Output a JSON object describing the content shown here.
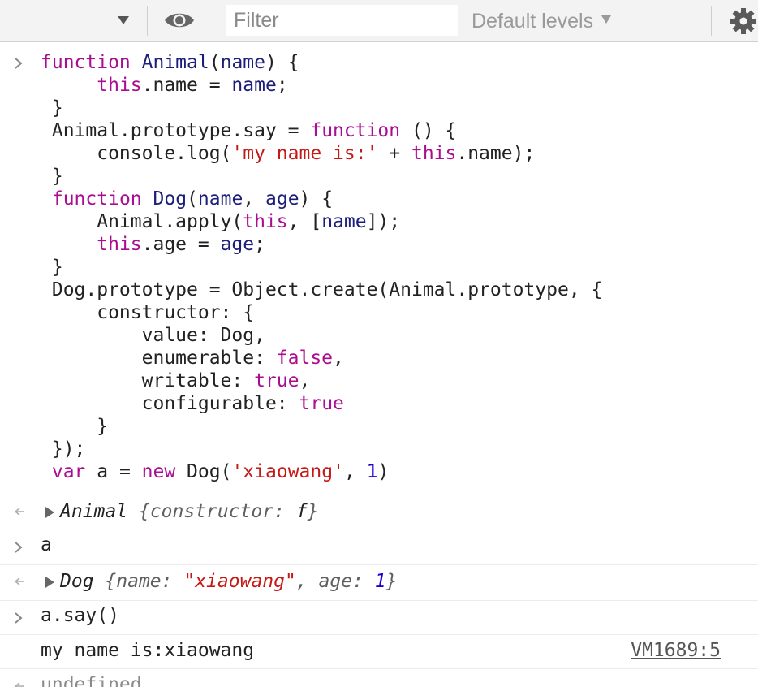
{
  "toolbar": {
    "filter_placeholder": "Filter",
    "levels_label": "Default levels",
    "icons": [
      "dropdown-arrow-icon",
      "eye-icon",
      "gear-icon"
    ]
  },
  "console": {
    "input1_lines": [
      "function Animal(name) {",
      "     this.name = name;",
      " }",
      " Animal.prototype.say = function () {",
      "     console.log('my name is:' + this.name);",
      " }",
      " function Dog(name, age) {",
      "     Animal.apply(this, [name]);",
      "     this.age = age;",
      " }",
      " Dog.prototype = Object.create(Animal.prototype, {",
      "     constructor: {",
      "         value: Dog,",
      "         enumerable: false,",
      "         writable: true,",
      "         configurable: true",
      "     }",
      " });",
      " var a = new Dog('xiaowang', 1)"
    ],
    "result1": {
      "name": "Animal",
      "open": "{",
      "key": "constructor",
      "colon": ": ",
      "value": "f",
      "close": "}"
    },
    "input2": "a",
    "result2": {
      "name": "Dog",
      "open": "{",
      "key1": "name",
      "colon1": ": ",
      "value1": "\"xiaowang\"",
      "sep": ", ",
      "key2": "age",
      "colon2": ": ",
      "value2": "1",
      "close": "}"
    },
    "input3": "a.say()",
    "log_output": "my name is:xiaowang",
    "log_source": "VM1689:5",
    "result3": "undefined"
  },
  "colors": {
    "keyword": "#aa0d91",
    "function_call": "#1c00cf",
    "string": "#c41a16",
    "number": "#1c00cf",
    "toolbar_bg": "#f3f3f3"
  }
}
